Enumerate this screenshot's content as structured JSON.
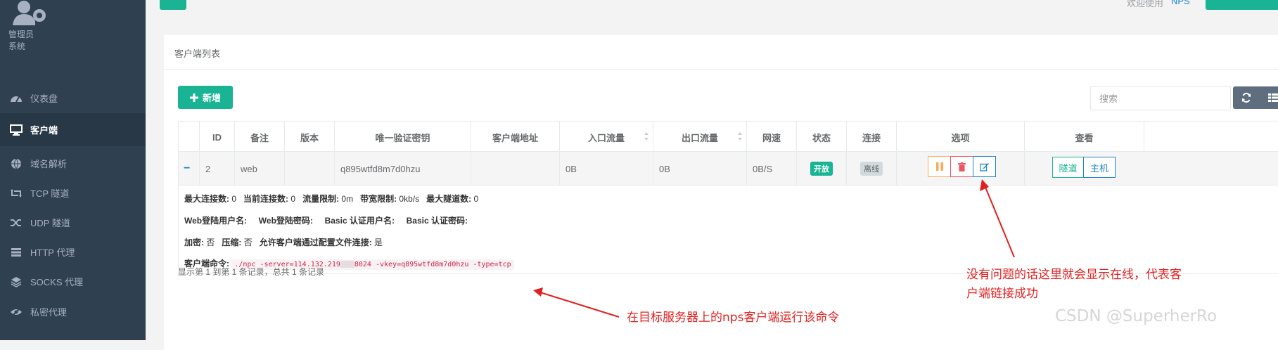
{
  "sidebar": {
    "role_lines": [
      "管理员",
      "系统"
    ],
    "items": [
      {
        "label": "仪表盘",
        "icon": "dashboard-icon"
      },
      {
        "label": "客户端",
        "icon": "desktop-icon",
        "active": true
      },
      {
        "label": "域名解析",
        "icon": "globe-icon"
      },
      {
        "label": "TCP 隧道",
        "icon": "retweet-icon"
      },
      {
        "label": "UDP 隧道",
        "icon": "random-icon"
      },
      {
        "label": "HTTP 代理",
        "icon": "server-icon"
      },
      {
        "label": "SOCKS 代理",
        "icon": "layers-icon"
      },
      {
        "label": "私密代理",
        "icon": "eye-slash-icon"
      }
    ]
  },
  "topbar": {
    "welcome": "欢迎使用",
    "lang": "NPS"
  },
  "panel": {
    "title": "客户端列表"
  },
  "toolbar": {
    "add_label": "新增",
    "search_placeholder": "搜索"
  },
  "table": {
    "headers": [
      "",
      "ID",
      "备注",
      "版本",
      "唯一验证密钥",
      "客户端地址",
      "入口流量",
      "出口流量",
      "网速",
      "状态",
      "连接",
      "选项",
      "查看"
    ],
    "row": {
      "expand": "−",
      "id": "2",
      "remark": "web",
      "version": "",
      "vkey": "q895wtfd8m7d0hzu",
      "address": "",
      "in_flow": "0B",
      "out_flow": "0B",
      "speed": "0B/S",
      "status": "开放",
      "connection": "离线",
      "view_buttons": [
        "隧道",
        "主机"
      ]
    },
    "detail": {
      "line1": [
        {
          "k": "最大连接数:",
          "v": " 0"
        },
        {
          "k": "当前连接数:",
          "v": " 0"
        },
        {
          "k": "流量限制:",
          "v": " 0m"
        },
        {
          "k": "带宽限制:",
          "v": " 0kb/s"
        },
        {
          "k": "最大隧道数:",
          "v": " 0"
        }
      ],
      "line2": [
        "Web登陆用户名:",
        "Web登陆密码:",
        "Basic 认证用户名:",
        "Basic 认证密码:"
      ],
      "line3": [
        {
          "k": "加密:",
          "v": " 否"
        },
        {
          "k": "压缩:",
          "v": " 否"
        },
        {
          "k": "允许客户端通过配置文件连接:",
          "v": " 是"
        }
      ],
      "cmd_label": "客户端命令:",
      "cmd_part1": "./npc -server=114.132.219",
      "cmd_part2": "8024 -vkey=q895wtfd8m7d0hzu -type=tcp"
    }
  },
  "pager": {
    "text": "显示第 1 到第 1 条记录，总共 1 条记录"
  },
  "annotations": {
    "status_note_1": "没有问题的话这里就会显示在线，代表客",
    "status_note_2": "户端链接成功",
    "cmd_note": "在目标服务器上的nps客户端运行该命令"
  },
  "watermark": "CSDN @SuperherRo",
  "colors": {
    "accent": "#1ab394",
    "sidebar": "#2f4050",
    "annotation": "#e02020",
    "warning": "#f8ac59",
    "danger": "#ed5565",
    "info": "#1c84c6"
  }
}
